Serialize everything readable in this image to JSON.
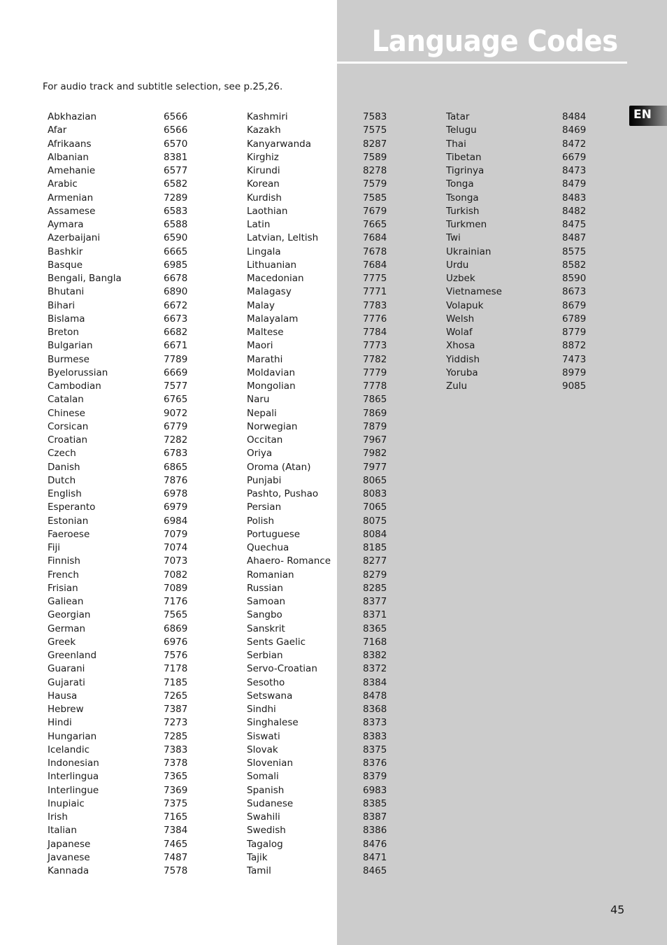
{
  "header": {
    "title": "Language Codes",
    "intro": "For audio track and subtitle selection, see p.25,26.",
    "language_tab": "EN"
  },
  "columns": [
    [
      {
        "name": "Abkhazian",
        "code": "6566"
      },
      {
        "name": "Afar",
        "code": "6566"
      },
      {
        "name": "Afrikaans",
        "code": "6570"
      },
      {
        "name": "Albanian",
        "code": "8381"
      },
      {
        "name": "Amehanie",
        "code": "6577"
      },
      {
        "name": "Arabic",
        "code": "6582"
      },
      {
        "name": "Armenian",
        "code": "7289"
      },
      {
        "name": "Assamese",
        "code": "6583"
      },
      {
        "name": "Aymara",
        "code": "6588"
      },
      {
        "name": "Azerbaijani",
        "code": "6590"
      },
      {
        "name": "Bashkir",
        "code": "6665"
      },
      {
        "name": "Basque",
        "code": "6985"
      },
      {
        "name": "Bengali, Bangla",
        "code": "6678"
      },
      {
        "name": "Bhutani",
        "code": "6890"
      },
      {
        "name": "Bihari",
        "code": "6672"
      },
      {
        "name": "Bislama",
        "code": "6673"
      },
      {
        "name": "Breton",
        "code": "6682"
      },
      {
        "name": "Bulgarian",
        "code": "6671"
      },
      {
        "name": "Burmese",
        "code": "7789"
      },
      {
        "name": "Byelorussian",
        "code": "6669"
      },
      {
        "name": "Cambodian",
        "code": "7577"
      },
      {
        "name": "Catalan",
        "code": "6765"
      },
      {
        "name": "Chinese",
        "code": "9072"
      },
      {
        "name": "Corsican",
        "code": "6779"
      },
      {
        "name": "Croatian",
        "code": "7282"
      },
      {
        "name": "Czech",
        "code": "6783"
      },
      {
        "name": "Danish",
        "code": "6865"
      },
      {
        "name": "Dutch",
        "code": "7876"
      },
      {
        "name": "English",
        "code": "6978"
      },
      {
        "name": "Esperanto",
        "code": "6979"
      },
      {
        "name": "Estonian",
        "code": "6984"
      },
      {
        "name": "Faeroese",
        "code": "7079"
      },
      {
        "name": "Fiji",
        "code": "7074"
      },
      {
        "name": "Finnish",
        "code": "7073"
      },
      {
        "name": "French",
        "code": "7082"
      },
      {
        "name": "Frisian",
        "code": "7089"
      },
      {
        "name": "Galiean",
        "code": "7176"
      },
      {
        "name": "Georgian",
        "code": "7565"
      },
      {
        "name": "German",
        "code": "6869"
      },
      {
        "name": "Greek",
        "code": "6976"
      },
      {
        "name": "Greenland",
        "code": "7576"
      },
      {
        "name": "Guarani",
        "code": "7178"
      },
      {
        "name": "Gujarati",
        "code": "7185"
      },
      {
        "name": "Hausa",
        "code": "7265"
      },
      {
        "name": "Hebrew",
        "code": "7387"
      },
      {
        "name": "Hindi",
        "code": "7273"
      },
      {
        "name": "Hungarian",
        "code": "7285"
      },
      {
        "name": "Icelandic",
        "code": "7383"
      },
      {
        "name": "Indonesian",
        "code": "7378"
      },
      {
        "name": "Interlingua",
        "code": "7365"
      },
      {
        "name": "Interlingue",
        "code": "7369"
      },
      {
        "name": "Inupiaic",
        "code": "7375"
      },
      {
        "name": "Irish",
        "code": "7165"
      },
      {
        "name": "Italian",
        "code": "7384"
      },
      {
        "name": "Japanese",
        "code": "7465"
      },
      {
        "name": "Javanese",
        "code": "7487"
      },
      {
        "name": "Kannada",
        "code": "7578"
      }
    ],
    [
      {
        "name": "Kashmiri",
        "code": "7583"
      },
      {
        "name": "Kazakh",
        "code": "7575"
      },
      {
        "name": "Kanyarwanda",
        "code": "8287"
      },
      {
        "name": "Kirghiz",
        "code": "7589"
      },
      {
        "name": "Kirundi",
        "code": "8278"
      },
      {
        "name": "Korean",
        "code": "7579"
      },
      {
        "name": "Kurdish",
        "code": "7585"
      },
      {
        "name": "Laothian",
        "code": "7679"
      },
      {
        "name": "Latin",
        "code": "7665"
      },
      {
        "name": "Latvian, Leltish",
        "code": "7684"
      },
      {
        "name": "Lingala",
        "code": "7678"
      },
      {
        "name": "Lithuanian",
        "code": "7684"
      },
      {
        "name": "Macedonian",
        "code": "7775"
      },
      {
        "name": "Malagasy",
        "code": "7771"
      },
      {
        "name": "Malay",
        "code": "7783"
      },
      {
        "name": "Malayalam",
        "code": "7776"
      },
      {
        "name": "Maltese",
        "code": "7784"
      },
      {
        "name": "Maori",
        "code": "7773"
      },
      {
        "name": "Marathi",
        "code": "7782"
      },
      {
        "name": "Moldavian",
        "code": "7779"
      },
      {
        "name": "Mongolian",
        "code": "7778"
      },
      {
        "name": "Naru",
        "code": "7865"
      },
      {
        "name": "Nepali",
        "code": "7869"
      },
      {
        "name": "Norwegian",
        "code": "7879"
      },
      {
        "name": "Occitan",
        "code": "7967"
      },
      {
        "name": "Oriya",
        "code": "7982"
      },
      {
        "name": "Oroma (Atan)",
        "code": "7977"
      },
      {
        "name": "Punjabi",
        "code": "8065"
      },
      {
        "name": "Pashto, Pushao",
        "code": "8083"
      },
      {
        "name": "Persian",
        "code": "7065"
      },
      {
        "name": "Polish",
        "code": "8075"
      },
      {
        "name": "Portuguese",
        "code": "8084"
      },
      {
        "name": "Quechua",
        "code": "8185"
      },
      {
        "name": "Ahaero- Romance",
        "code": "8277"
      },
      {
        "name": "Romanian",
        "code": "8279"
      },
      {
        "name": "Russian",
        "code": "8285"
      },
      {
        "name": "Samoan",
        "code": "8377"
      },
      {
        "name": "Sangbo",
        "code": "8371"
      },
      {
        "name": "Sanskrit",
        "code": "8365"
      },
      {
        "name": "Sents Gaelic",
        "code": "7168"
      },
      {
        "name": "Serbian",
        "code": "8382"
      },
      {
        "name": "Servo-Croatian",
        "code": "8372"
      },
      {
        "name": "Sesotho",
        "code": "8384"
      },
      {
        "name": "Setswana",
        "code": "8478"
      },
      {
        "name": "Sindhi",
        "code": "8368"
      },
      {
        "name": "Singhalese",
        "code": "8373"
      },
      {
        "name": "Siswati",
        "code": "8383"
      },
      {
        "name": "Slovak",
        "code": "8375"
      },
      {
        "name": "Slovenian",
        "code": "8376"
      },
      {
        "name": "Somali",
        "code": "8379"
      },
      {
        "name": "Spanish",
        "code": "6983"
      },
      {
        "name": "Sudanese",
        "code": "8385"
      },
      {
        "name": "Swahili",
        "code": "8387"
      },
      {
        "name": "Swedish",
        "code": "8386"
      },
      {
        "name": "Tagalog",
        "code": "8476"
      },
      {
        "name": "Tajik",
        "code": "8471"
      },
      {
        "name": "Tamil",
        "code": "8465"
      }
    ],
    [
      {
        "name": "Tatar",
        "code": "8484"
      },
      {
        "name": "Telugu",
        "code": "8469"
      },
      {
        "name": "Thai",
        "code": "8472"
      },
      {
        "name": "Tibetan",
        "code": "6679"
      },
      {
        "name": "Tigrinya",
        "code": "8473"
      },
      {
        "name": "Tonga",
        "code": "8479"
      },
      {
        "name": "Tsonga",
        "code": "8483"
      },
      {
        "name": "Turkish",
        "code": "8482"
      },
      {
        "name": "Turkmen",
        "code": "8475"
      },
      {
        "name": "Twi",
        "code": "8487"
      },
      {
        "name": "Ukrainian",
        "code": "8575"
      },
      {
        "name": "Urdu",
        "code": "8582"
      },
      {
        "name": "Uzbek",
        "code": "8590"
      },
      {
        "name": "Vietnamese",
        "code": "8673"
      },
      {
        "name": "Volapuk",
        "code": "8679"
      },
      {
        "name": "Welsh",
        "code": "6789"
      },
      {
        "name": "Wolaf",
        "code": "8779"
      },
      {
        "name": "Xhosa",
        "code": "8872"
      },
      {
        "name": "Yiddish",
        "code": "7473"
      },
      {
        "name": "Yoruba",
        "code": "8979"
      },
      {
        "name": "Zulu",
        "code": "9085"
      }
    ]
  ],
  "footer": {
    "page_number": "45"
  }
}
